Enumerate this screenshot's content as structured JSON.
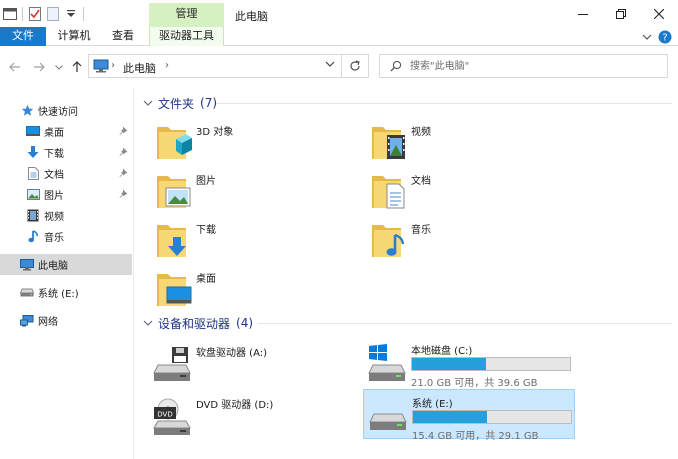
{
  "window": {
    "context_tab": "管理",
    "title": "此电脑"
  },
  "ribbon": {
    "tabs": [
      "文件",
      "计算机",
      "查看",
      "驱动器工具"
    ]
  },
  "address": {
    "path": "此电脑",
    "search_placeholder": "搜索\"此电脑\""
  },
  "nav": {
    "quick_access": "快速访问",
    "items": [
      "桌面",
      "下载",
      "文档",
      "图片",
      "视频",
      "音乐"
    ],
    "this_pc": "此电脑",
    "drive": "系统 (E:)",
    "network": "网络"
  },
  "folders_group": {
    "label": "文件夹",
    "count": "(7)",
    "items": [
      "3D 对象",
      "视频",
      "图片",
      "文档",
      "下载",
      "音乐",
      "桌面"
    ]
  },
  "devices_group": {
    "label": "设备和驱动器",
    "count": "(4)",
    "items": [
      {
        "name": "软盘驱动器 (A:)"
      },
      {
        "name": "本地磁盘 (C:)",
        "space": "21.0 GB 可用，共 39.6 GB",
        "used_fraction": 0.47
      },
      {
        "name": "DVD 驱动器 (D:)"
      },
      {
        "name": "系统 (E:)",
        "space": "15.4 GB 可用，共 29.1 GB",
        "used_fraction": 0.47
      }
    ]
  },
  "colors": {
    "accent": "#1979ca",
    "context_tab": "#d6f0c2",
    "group_header": "#1e3287",
    "folder_yellow": "#f8d775",
    "drive_bar": "#26a0da",
    "selection": "#cce8ff"
  }
}
